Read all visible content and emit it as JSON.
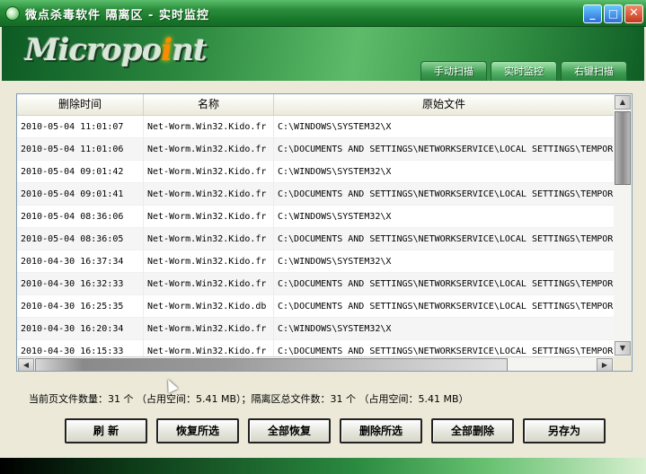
{
  "window": {
    "title": "微点杀毒软件  隔离区 - 实时监控",
    "minimize_glyph": "_",
    "maximize_glyph": "□",
    "close_glyph": "✕"
  },
  "banner": {
    "logo_prefix": "Micropo",
    "logo_dot": "i",
    "logo_suffix": "nt"
  },
  "tabs": [
    {
      "label": "手动扫描"
    },
    {
      "label": "实时监控",
      "active": true
    },
    {
      "label": "右键扫描"
    }
  ],
  "table": {
    "columns": [
      "删除时间",
      "名称",
      "原始文件"
    ],
    "rows": [
      {
        "time": "2010-05-04 11:01:07",
        "name": "Net-Worm.Win32.Kido.fr",
        "path": "C:\\WINDOWS\\SYSTEM32\\X"
      },
      {
        "time": "2010-05-04 11:01:06",
        "name": "Net-Worm.Win32.Kido.fr",
        "path": "C:\\DOCUMENTS AND SETTINGS\\NETWORKSERVICE\\LOCAL SETTINGS\\TEMPOR"
      },
      {
        "time": "2010-05-04 09:01:42",
        "name": "Net-Worm.Win32.Kido.fr",
        "path": "C:\\WINDOWS\\SYSTEM32\\X"
      },
      {
        "time": "2010-05-04 09:01:41",
        "name": "Net-Worm.Win32.Kido.fr",
        "path": "C:\\DOCUMENTS AND SETTINGS\\NETWORKSERVICE\\LOCAL SETTINGS\\TEMPOR"
      },
      {
        "time": "2010-05-04 08:36:06",
        "name": "Net-Worm.Win32.Kido.fr",
        "path": "C:\\WINDOWS\\SYSTEM32\\X"
      },
      {
        "time": "2010-05-04 08:36:05",
        "name": "Net-Worm.Win32.Kido.fr",
        "path": "C:\\DOCUMENTS AND SETTINGS\\NETWORKSERVICE\\LOCAL SETTINGS\\TEMPOR"
      },
      {
        "time": "2010-04-30 16:37:34",
        "name": "Net-Worm.Win32.Kido.fr",
        "path": "C:\\WINDOWS\\SYSTEM32\\X"
      },
      {
        "time": "2010-04-30 16:32:33",
        "name": "Net-Worm.Win32.Kido.fr",
        "path": "C:\\DOCUMENTS AND SETTINGS\\NETWORKSERVICE\\LOCAL SETTINGS\\TEMPOR"
      },
      {
        "time": "2010-04-30 16:25:35",
        "name": "Net-Worm.Win32.Kido.db",
        "path": "C:\\DOCUMENTS AND SETTINGS\\NETWORKSERVICE\\LOCAL SETTINGS\\TEMPOR"
      },
      {
        "time": "2010-04-30 16:20:34",
        "name": "Net-Worm.Win32.Kido.fr",
        "path": "C:\\WINDOWS\\SYSTEM32\\X"
      },
      {
        "time": "2010-04-30 16:15:33",
        "name": "Net-Worm.Win32.Kido.fr",
        "path": "C:\\DOCUMENTS AND SETTINGS\\NETWORKSERVICE\\LOCAL SETTINGS\\TEMPOR"
      }
    ]
  },
  "scrollbar": {
    "up": "▲",
    "down": "▼",
    "left": "◀",
    "right": "▶"
  },
  "status_text": "当前页文件数量：31 个 （占用空间：5.41 MB）；隔离区总文件数：31 个 （占用空间：5.41 MB）",
  "buttons": {
    "refresh": "刷    新",
    "restore_selected": "恢复所选",
    "restore_all": "全部恢复",
    "delete_selected": "删除所选",
    "delete_all": "全部删除",
    "save_as": "另存为"
  },
  "colors": {
    "title_green": "#1a7a2c",
    "banner_green": "#2d8a40",
    "logo_dot": "#ff8a00"
  }
}
